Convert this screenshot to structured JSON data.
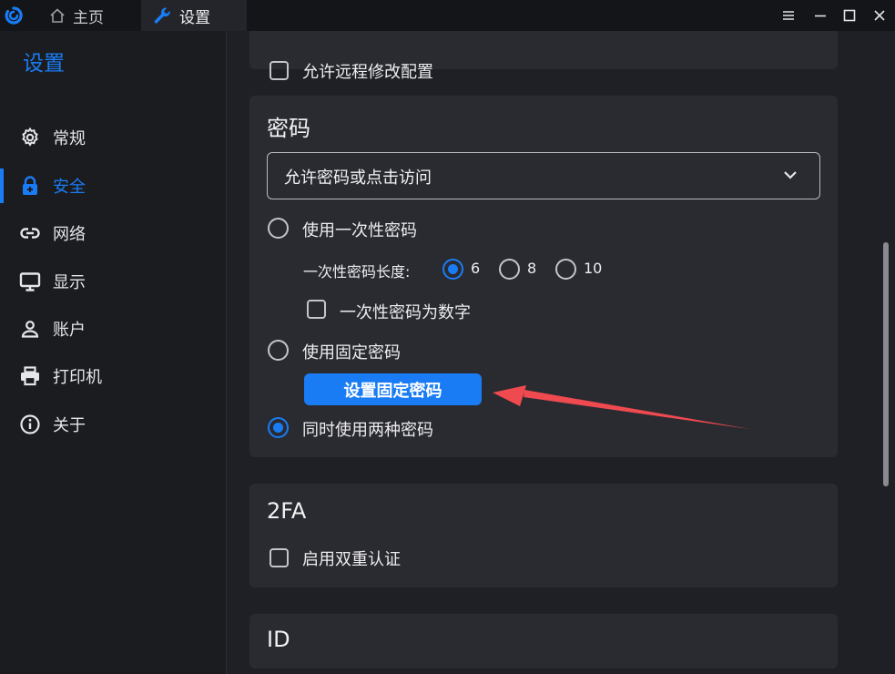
{
  "titlebar": {
    "tabs": [
      {
        "label": "主页",
        "icon": "home-icon"
      },
      {
        "label": "设置",
        "icon": "wrench-icon"
      }
    ]
  },
  "sidebar": {
    "title": "设置",
    "items": [
      {
        "label": "常规",
        "icon": "gear-icon"
      },
      {
        "label": "安全",
        "icon": "lock-icon",
        "active": true
      },
      {
        "label": "网络",
        "icon": "link-icon"
      },
      {
        "label": "显示",
        "icon": "monitor-icon"
      },
      {
        "label": "账户",
        "icon": "user-icon"
      },
      {
        "label": "打印机",
        "icon": "printer-icon"
      },
      {
        "label": "关于",
        "icon": "info-icon"
      }
    ]
  },
  "main": {
    "prev_card": {
      "checkbox_label": "允许远程修改配置"
    },
    "password": {
      "title": "密码",
      "select_value": "允许密码或点击访问",
      "radio_one_time": "使用一次性密码",
      "length_label": "一次性密码长度:",
      "length_options": [
        "6",
        "8",
        "10"
      ],
      "numeric_label": "一次性密码为数字",
      "radio_fixed": "使用固定密码",
      "set_fixed_button": "设置固定密码",
      "radio_both": "同时使用两种密码"
    },
    "twofa": {
      "title": "2FA",
      "checkbox_label": "启用双重认证"
    },
    "id_card": {
      "title": "ID"
    }
  },
  "colors": {
    "accent": "#1a7cf5",
    "annotation": "#ef4a4f"
  }
}
